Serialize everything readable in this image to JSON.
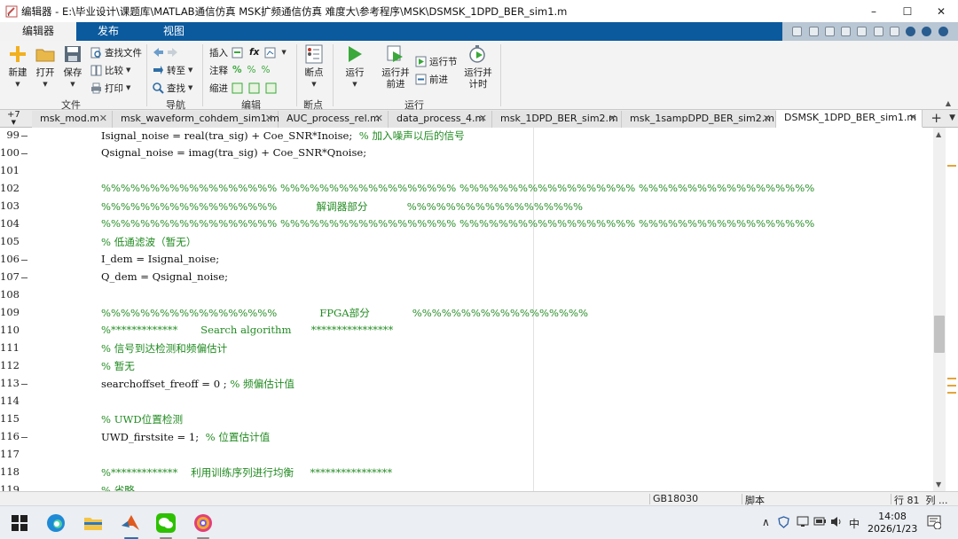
{
  "window": {
    "title": "编辑器 - E:\\毕业设计\\课题库\\MATLAB通信仿真 MSK扩频通信仿真 难度大\\参考程序\\MSK\\DSMSK_1DPD_BER_sim1.m",
    "minimize": "–",
    "maximize": "☐",
    "close": "✕"
  },
  "ribbon": {
    "tabs": [
      "编辑器",
      "发布",
      "视图"
    ],
    "active_tab": "编辑器",
    "file_group": {
      "label": "文件",
      "new": "新建",
      "open": "打开",
      "save": "保存",
      "find_files": "查找文件",
      "compare": "比较",
      "print": "打印"
    },
    "nav_group": {
      "label": "导航",
      "goto": "转至",
      "find": "查找"
    },
    "edit_group": {
      "label": "编辑",
      "insert": "插入",
      "comment": "注释",
      "indent": "缩进",
      "fx": "fx"
    },
    "breakpoints_group": {
      "label": "断点",
      "breakpoints": "断点"
    },
    "run_group": {
      "label": "运行",
      "run": "运行",
      "run_advance_l1": "运行并",
      "run_advance_l2": "前进",
      "run_section": "运行节",
      "advance": "前进",
      "run_time_l1": "运行并",
      "run_time_l2": "计时"
    }
  },
  "file_tabs": {
    "overflow": "+7",
    "tabs": [
      "msk_mod.m",
      "msk_waveform_cohdem_sim1.m",
      "AUC_process_rel.m",
      "data_process_4.m",
      "msk_1DPD_BER_sim2.m",
      "msk_1sampDPD_BER_sim2.m",
      "DSMSK_1DPD_BER_sim1.m"
    ],
    "active": "DSMSK_1DPD_BER_sim1.m",
    "add": "+"
  },
  "editor": {
    "lines": [
      {
        "n": "99",
        "code": "Isignal_noise = real(tra_sig) + Coe_SNR*Inoise;  ",
        "comment": "% 加入噪声以后的信号",
        "mark": true
      },
      {
        "n": "100",
        "code": "Qsignal_noise = imag(tra_sig) + Coe_SNR*Qnoise;",
        "comment": "",
        "mark": true
      },
      {
        "n": "101",
        "code": "",
        "comment": "",
        "mark": false
      },
      {
        "n": "102",
        "code": "",
        "comment": "%%%%%%%%%%%%%%%%%% %%%%%%%%%%%%%%%%%% %%%%%%%%%%%%%%%%%% %%%%%%%%%%%%%%%%%%",
        "mark": false
      },
      {
        "n": "103",
        "code": "",
        "comment": "%%%%%%%%%%%%%%%%%%            解调器部分            %%%%%%%%%%%%%%%%%%",
        "mark": false
      },
      {
        "n": "104",
        "code": "",
        "comment": "%%%%%%%%%%%%%%%%%% %%%%%%%%%%%%%%%%%% %%%%%%%%%%%%%%%%%% %%%%%%%%%%%%%%%%%%",
        "mark": false
      },
      {
        "n": "105",
        "code": "",
        "comment": "% 低通滤波（暂无）",
        "mark": false
      },
      {
        "n": "106",
        "code": "I_dem = Isignal_noise;",
        "comment": "",
        "mark": true
      },
      {
        "n": "107",
        "code": "Q_dem = Qsignal_noise;",
        "comment": "",
        "mark": true
      },
      {
        "n": "108",
        "code": "",
        "comment": "",
        "mark": false
      },
      {
        "n": "109",
        "code": "",
        "comment": "%%%%%%%%%%%%%%%%%%             FPGA部分             %%%%%%%%%%%%%%%%%%",
        "mark": false
      },
      {
        "n": "110",
        "code": "",
        "comment": "%*************       Search algorithm      ****************",
        "mark": false
      },
      {
        "n": "111",
        "code": "",
        "comment": "% 信号到达检测和频偏估计",
        "mark": false
      },
      {
        "n": "112",
        "code": "",
        "comment": "% 暂无",
        "mark": false
      },
      {
        "n": "113",
        "code": "searchoffset_freoff = 0 ; ",
        "comment": "% 频偏估计值",
        "mark": true
      },
      {
        "n": "114",
        "code": "",
        "comment": "",
        "mark": false
      },
      {
        "n": "115",
        "code": "",
        "comment": "% UWD位置检测",
        "mark": false
      },
      {
        "n": "116",
        "code": "UWD_firstsite = 1;  ",
        "comment": "% 位置估计值",
        "mark": true
      },
      {
        "n": "117",
        "code": "",
        "comment": "",
        "mark": false
      },
      {
        "n": "118",
        "code": "",
        "comment": "%*************    利用训练序列进行均衡     ****************",
        "mark": false
      },
      {
        "n": "119",
        "code": "",
        "comment": "% 省略",
        "mark": false
      }
    ]
  },
  "statusbar": {
    "encoding": "GB18030",
    "type": "脚本",
    "position": "行 81  列 ..."
  },
  "taskbar": {
    "time": "14:08",
    "date": "2026/1/23",
    "ime": "中",
    "chevron": "∧"
  },
  "colors": {
    "ribbon_blue": "#0c5a9e",
    "comment_green": "#228b22",
    "run_green": "#3aa83a"
  }
}
